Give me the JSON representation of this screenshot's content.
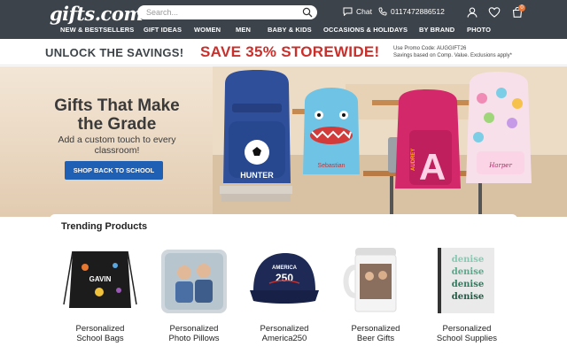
{
  "header": {
    "logo": "gifts.com",
    "search_placeholder": "Search...",
    "chat_label": "Chat",
    "phone": "01174728865​12",
    "cart_count": "0"
  },
  "nav": {
    "items": [
      "NEW & BESTSELLERS",
      "GIFT IDEAS",
      "WOMEN",
      "MEN",
      "BABY & KIDS",
      "OCCASIONS & HOLIDAYS",
      "BY BRAND",
      "PHOTO"
    ]
  },
  "promo": {
    "left": "UNLOCK THE SAVINGS!",
    "middle": "SAVE 35% STOREWIDE!",
    "code_line": "Use Promo Code: AUGGIFT26",
    "disclaimer": "Savings based on Comp. Value. Exclusions apply*"
  },
  "hero": {
    "title": "Gifts That Make the Grade",
    "subtitle": "Add a custom touch to every classroom!",
    "button": "SHOP BACK TO SCHOOL",
    "backpack_names": [
      "HUNTER",
      "Sebastian",
      "AUDREY",
      "Harper"
    ],
    "backpack_letter": "A",
    "colors": {
      "button": "#1f5fb4",
      "promo_red": "#c9302c",
      "header": "#3c434a"
    }
  },
  "trending": {
    "title": "Trending Products",
    "products": [
      {
        "line1": "Personalized",
        "line2": "School Bags",
        "image_text": "GAVIN"
      },
      {
        "line1": "Personalized",
        "line2": "Photo Pillows"
      },
      {
        "line1": "Personalized",
        "line2": "America250",
        "image_text": "AMERICA",
        "image_number": "250"
      },
      {
        "line1": "Personalized",
        "line2": "Beer Gifts"
      },
      {
        "line1": "Personalized",
        "line2": "School Supplies",
        "image_text": "denise"
      }
    ]
  }
}
